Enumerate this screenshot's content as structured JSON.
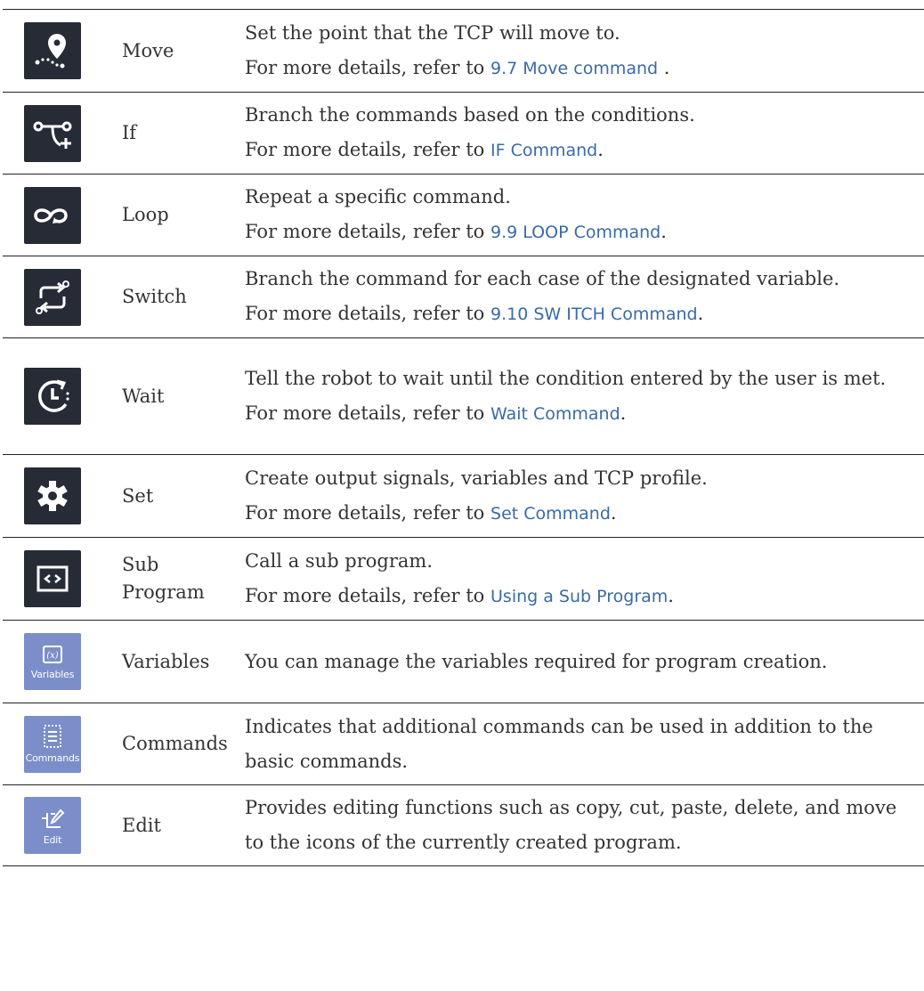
{
  "rows": [
    {
      "icon": "move-location-icon",
      "name": "Move",
      "line1": "Set the point that the TCP will move to.",
      "prefix": "For more details, refer to ",
      "link": "9.7 Move command",
      "suffix": " ."
    },
    {
      "icon": "if-branch-icon",
      "name": "If",
      "line1": "Branch the commands based on the conditions.",
      "prefix": "For more details, refer to ",
      "link": "IF Command",
      "suffix": "."
    },
    {
      "icon": "loop-icon",
      "name": "Loop",
      "line1": "Repeat a specific command.",
      "prefix": "For more details, refer to ",
      "link": "9.9 LOOP Command",
      "suffix": "."
    },
    {
      "icon": "switch-icon",
      "name": "Switch",
      "line1": "Branch the command for each case of the designated variable.",
      "prefix": "For more details, refer to ",
      "link": "9.10 SW ITCH Command",
      "suffix": "."
    },
    {
      "icon": "wait-clock-icon",
      "name": "Wait",
      "line1": "Tell the robot to wait until the condition entered by the user is met.",
      "prefix": "For more details, refer to ",
      "link": "Wait Command",
      "suffix": "."
    },
    {
      "icon": "gear-icon",
      "name": "Set",
      "line1": "Create output signals, variables and TCP profile.",
      "prefix": "For more details, refer to ",
      "link": "Set Command",
      "suffix": "."
    },
    {
      "icon": "code-window-icon",
      "name": "Sub Program",
      "line1": "Call a sub program.",
      "prefix": "For more details, refer to ",
      "link": "Using a Sub Program",
      "suffix": "."
    },
    {
      "icon": "variables-icon",
      "icon_label": "Variables",
      "name": "Variables",
      "line1": "You can manage the variables required for program creation."
    },
    {
      "icon": "commands-list-icon",
      "icon_label": "Commands",
      "name": "Commands",
      "line1": "Indicates that additional commands can be used in addition to the basic commands."
    },
    {
      "icon": "edit-icon",
      "icon_label": "Edit",
      "name": "Edit",
      "line1": "Provides editing functions such as copy, cut, paste, delete, and move to the icons of the currently created program."
    }
  ],
  "colors": {
    "dark_icon_bg": "#262b36",
    "light_icon_bg": "#7c8ec9",
    "link": "#3a6aa8"
  }
}
